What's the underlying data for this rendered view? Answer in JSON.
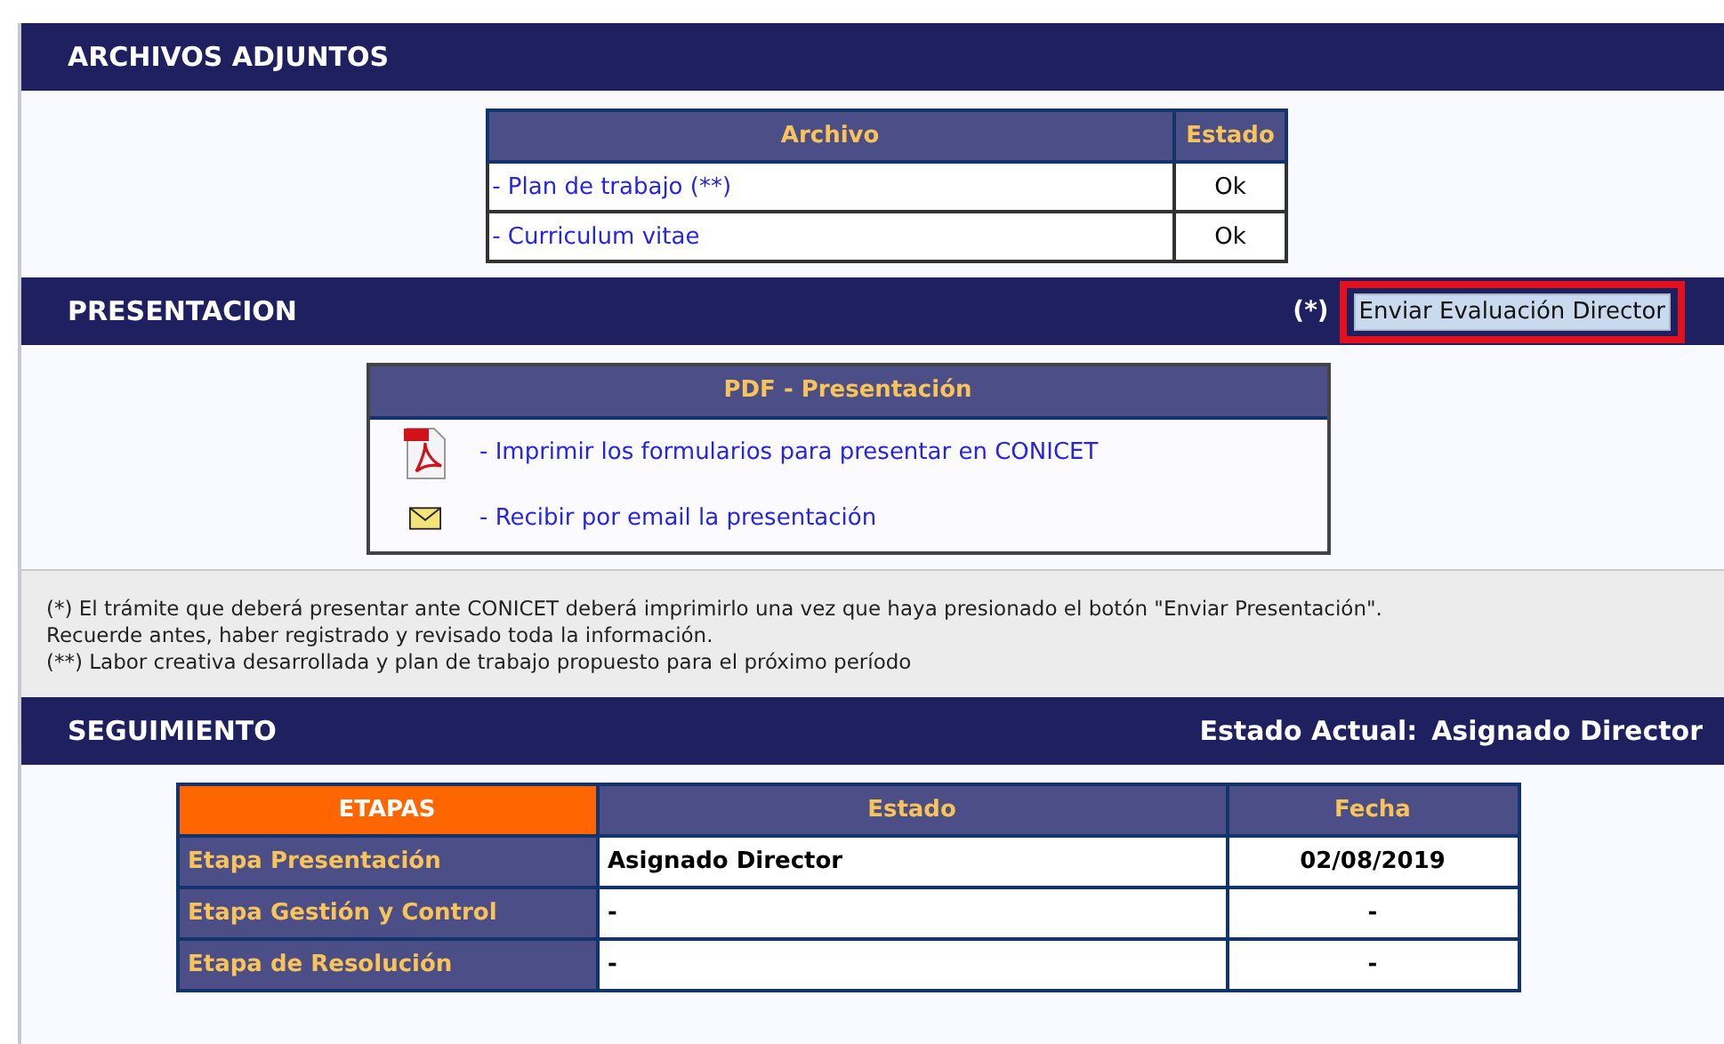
{
  "attachments": {
    "title": "ARCHIVOS ADJUNTOS",
    "columns": [
      "Archivo",
      "Estado"
    ],
    "rows": [
      {
        "file": "- Plan de trabajo (**)",
        "status": "Ok"
      },
      {
        "file": "- Curriculum vitae",
        "status": "Ok"
      }
    ]
  },
  "presentation": {
    "title": "PRESENTACION",
    "note_mark": "(*)",
    "button": {
      "label": "Enviar Evaluación Director",
      "highlighted": true
    },
    "pdf_box": {
      "title": "PDF - Presentación",
      "links": [
        {
          "kind": "pdf",
          "label": "- Imprimir los formularios para presentar en CONICET"
        },
        {
          "kind": "email",
          "label": "- Recibir por email la presentación"
        }
      ]
    }
  },
  "notes": [
    "(*) El trámite que deberá presentar ante CONICET deberá imprimirlo una vez que haya presionado el botón \"Enviar Presentación\".",
    "Recuerde antes, haber registrado y revisado toda la información.",
    "(**) Labor creativa desarrollada y plan de trabajo propuesto para el próximo período"
  ],
  "tracking": {
    "title": "SEGUIMIENTO",
    "current_state_label": "Estado Actual:",
    "current_state": "Asignado Director",
    "columns": [
      "ETAPAS",
      "Estado",
      "Fecha"
    ],
    "rows": [
      {
        "stage": "Etapa Presentación",
        "state": "Asignado Director",
        "date": "02/08/2019"
      },
      {
        "stage": "Etapa Gestión y Control",
        "state": "-",
        "date": "-"
      },
      {
        "stage": "Etapa de Resolución",
        "state": "-",
        "date": "-"
      }
    ]
  }
}
